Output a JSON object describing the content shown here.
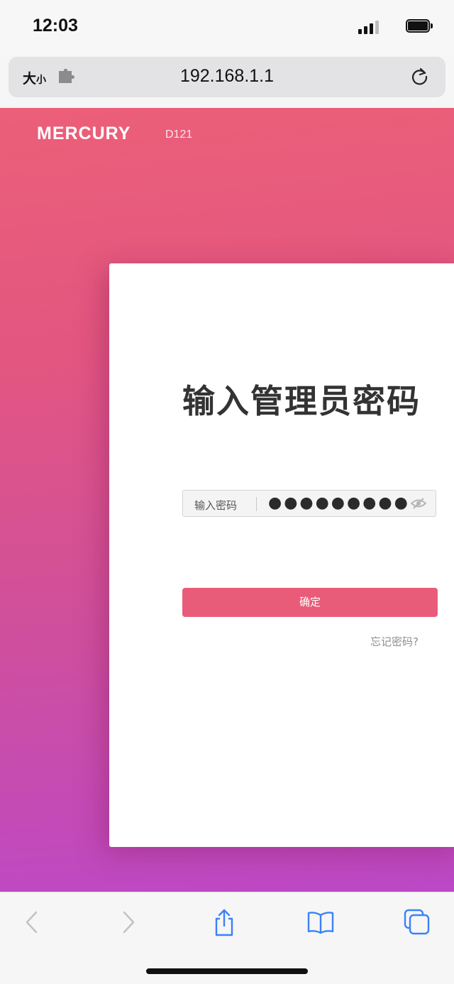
{
  "status_bar": {
    "time": "12:03"
  },
  "browser": {
    "text_size_label_big": "大",
    "text_size_label_small": "小",
    "url": "192.168.1.1"
  },
  "page": {
    "brand": "MERCURY",
    "model": "D121",
    "title": "输入管理员密码",
    "password_label": "输入密码",
    "password_value": "●●●●●●●●●",
    "submit_label": "确定",
    "forgot_label": "忘记密码?"
  },
  "colors": {
    "accent": "#e85c79",
    "gradient_top": "#ec5f79",
    "gradient_bottom": "#bc48c6",
    "ios_blue": "#3a82f7"
  },
  "icons": {
    "extension": "puzzle-icon",
    "reload": "reload-icon",
    "password_toggle": "eye-hidden-icon",
    "back": "chevron-left-icon",
    "forward": "chevron-right-icon",
    "share": "share-icon",
    "bookmarks": "book-icon",
    "tabs": "tabs-icon"
  }
}
